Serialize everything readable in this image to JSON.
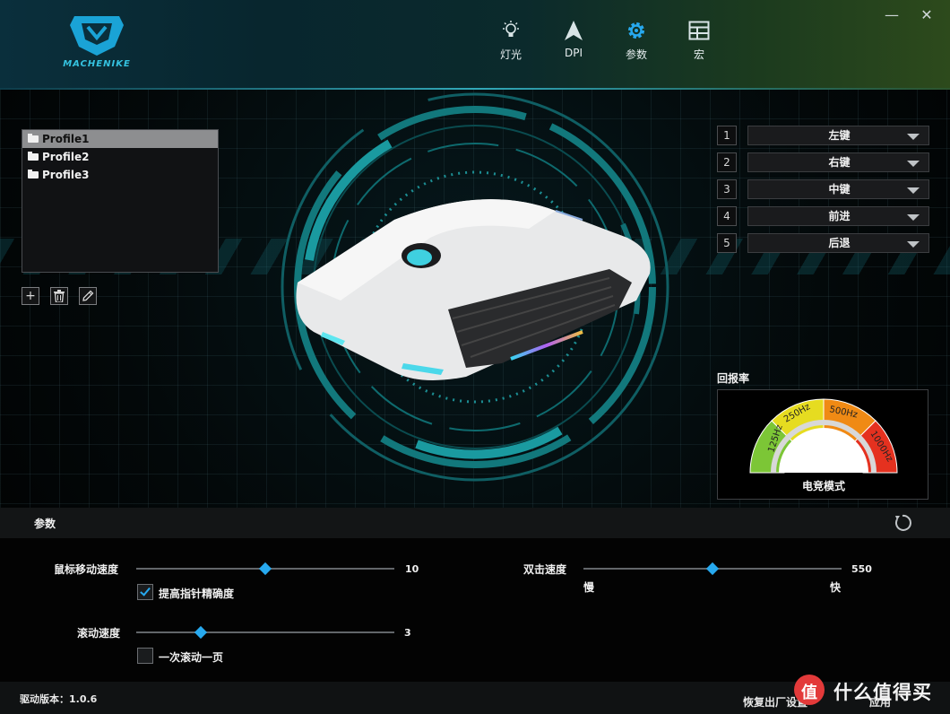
{
  "app": {
    "logo_text": "MACHENIKE"
  },
  "nav": [
    {
      "label": "灯光",
      "icon": "lightbulb-icon"
    },
    {
      "label": "DPI",
      "icon": "cursor-arrow-icon"
    },
    {
      "label": "参数",
      "icon": "gear-icon"
    },
    {
      "label": "宏",
      "icon": "grid-table-icon"
    }
  ],
  "window_controls": {
    "minimize": "—",
    "close": "✕"
  },
  "profiles": {
    "items": [
      "Profile1",
      "Profile2",
      "Profile3"
    ],
    "selected": "Profile1"
  },
  "profile_tools": {
    "add": "+",
    "delete": "trash-icon",
    "edit": "pencil-icon"
  },
  "buttons": [
    {
      "num": "1",
      "value": "左键"
    },
    {
      "num": "2",
      "value": "右键"
    },
    {
      "num": "3",
      "value": "中键"
    },
    {
      "num": "4",
      "value": "前进"
    },
    {
      "num": "5",
      "value": "后退"
    }
  ],
  "report_rate": {
    "title": "回报率",
    "levels": [
      "125Hz",
      "250Hz",
      "500Hz",
      "1000Hz"
    ],
    "level_colors": [
      "#7cc636",
      "#e6dc20",
      "#f08a14",
      "#e5311f"
    ],
    "mode": "电竞模式"
  },
  "params": {
    "title": "参数",
    "mouse_speed": {
      "label": "鼠标移动速度",
      "value": "10",
      "position": 0.5
    },
    "precision": {
      "label": "提高指针精确度",
      "checked": true
    },
    "scroll_speed": {
      "label": "滚动速度",
      "value": "3",
      "position": 0.25
    },
    "scroll_page": {
      "label": "一次滚动一页",
      "checked": false
    },
    "double_click": {
      "label": "双击速度",
      "value": "550",
      "position": 0.5,
      "min_label": "慢",
      "max_label": "快"
    }
  },
  "footer": {
    "version": "驱动版本：1.0.6",
    "restore": "恢复出厂设置",
    "apply": "应用"
  },
  "watermark": {
    "mark": "值",
    "text": "什么值得买"
  },
  "accent_color": "#27a9ef"
}
